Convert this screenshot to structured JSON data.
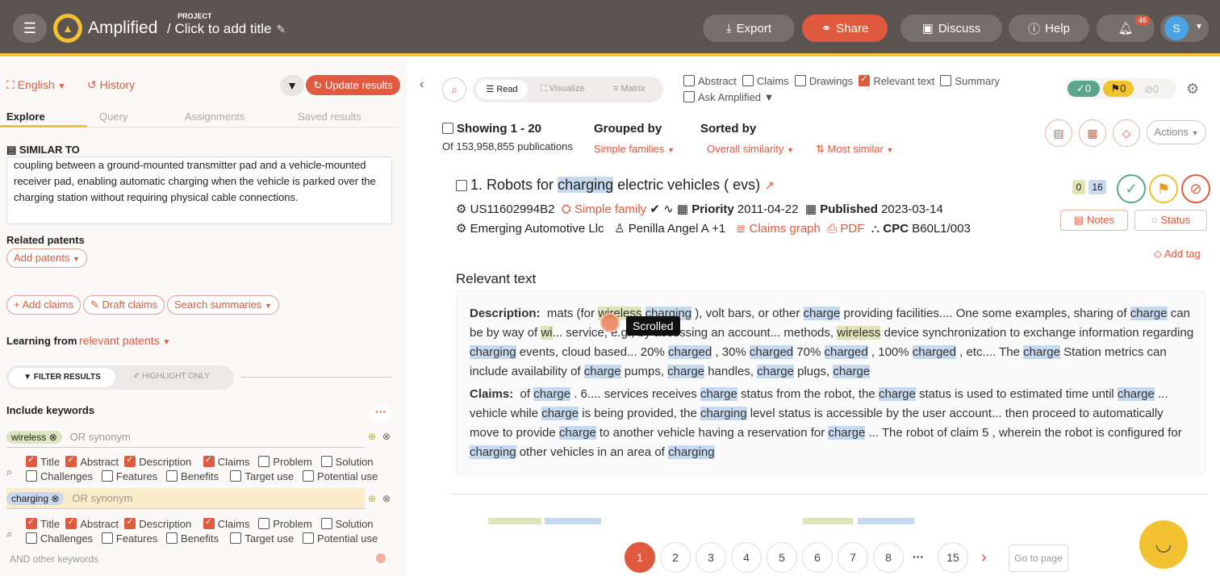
{
  "header": {
    "app_name": "Amplified",
    "project_label": "PROJECT",
    "project_title": "/ Click to add title",
    "export": "Export",
    "share": "Share",
    "discuss": "Discuss",
    "help": "Help",
    "notif_count": "46",
    "avatar_letter": "S"
  },
  "left": {
    "language": "English",
    "history": "History",
    "update_results": "Update results",
    "tabs": [
      "Explore",
      "Query",
      "Assignments",
      "Saved results"
    ],
    "similar_to": "SIMILAR TO",
    "similar_text": "coupling between a ground-mounted transmitter pad and a vehicle-mounted receiver pad, enabling automatic charging when the vehicle is parked over the charging station without requiring physical cable connections.",
    "related_patents": "Related patents",
    "add_patents": "Add patents",
    "add_claims": "+ Add claims",
    "draft_claims": "Draft claims",
    "search_summaries": "Search summaries",
    "learning_from": "Learning from",
    "learning_value": "relevant patents",
    "filter_results": "FILTER RESULTS",
    "highlight_only": "HIGHLIGHT ONLY",
    "include_keywords": "Include keywords",
    "more": "···",
    "kw1": "wireless",
    "kw2": "charging",
    "or_synonym": "OR synonym",
    "fields": {
      "title": "Title",
      "abstract": "Abstract",
      "description": "Description",
      "claims": "Claims",
      "problem": "Problem",
      "solution": "Solution",
      "challenges": "Challenges",
      "features": "Features",
      "benefits": "Benefits",
      "target_use": "Target use",
      "potential_use": "Potential use"
    },
    "and_other": "AND other keywords"
  },
  "right": {
    "read": "Read",
    "visualize": "Visualize",
    "matrix": "Matrix",
    "opts": {
      "abstract": "Abstract",
      "claims": "Claims",
      "drawings": "Drawings",
      "relevant_text": "Relevant text",
      "summary": "Summary",
      "ask": "Ask Amplified"
    },
    "counts": {
      "green": "0",
      "yellow": "0",
      "grey": "0"
    },
    "showing": "Showing 1 - 20",
    "of_pubs": "Of 153,958,855 publications",
    "grouped_by": "Grouped by",
    "grouped_val": "Simple families",
    "sorted_by": "Sorted by",
    "sorted_val": "Overall similarity",
    "most_similar": "Most similar",
    "actions": "Actions",
    "result": {
      "num": "1. Robots for ",
      "hl": "charging",
      "rest": " electric vehicles ( evs)",
      "pubno": "US11602994B2",
      "family": "Simple family",
      "priority_lbl": "Priority",
      "priority": "2011-04-22",
      "published_lbl": "Published",
      "published": "2023-03-14",
      "assignee": "Emerging Automotive Llc",
      "inventor": "Penilla Angel A +1",
      "claims_graph": "Claims graph",
      "pdf": "PDF",
      "cpc_lbl": "CPC",
      "cpc": "B60L1/003",
      "c1": "0",
      "c2": "16",
      "notes": "Notes",
      "status": "Status",
      "add_tag": "Add tag"
    },
    "relevant_text": "Relevant text",
    "desc_lbl": "Description:",
    "claims_lbl": "Claims:",
    "tooltip": "Scrolled",
    "pages": [
      "1",
      "2",
      "3",
      "4",
      "5",
      "6",
      "7",
      "8",
      "···",
      "15"
    ],
    "goto": "Go to page"
  }
}
